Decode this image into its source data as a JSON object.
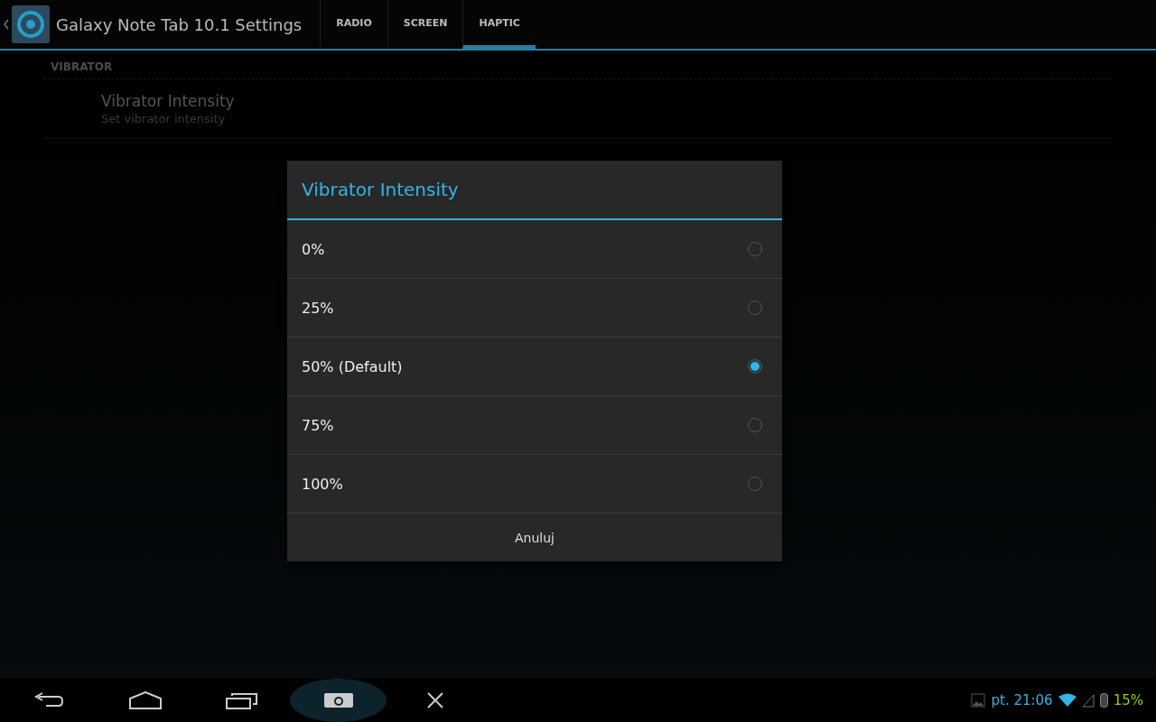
{
  "action_bar": {
    "title": "Galaxy Note Tab 10.1 Settings",
    "tabs": [
      {
        "label": "RADIO",
        "selected": false
      },
      {
        "label": "SCREEN",
        "selected": false
      },
      {
        "label": "HAPTIC",
        "selected": true
      }
    ]
  },
  "section": {
    "header": "VIBRATOR",
    "items": [
      {
        "title": "Vibrator Intensity",
        "summary": "Set vibrator intensity"
      }
    ]
  },
  "dialog": {
    "title": "Vibrator Intensity",
    "options": [
      {
        "label": "0%",
        "selected": false
      },
      {
        "label": "25%",
        "selected": false
      },
      {
        "label": "50% (Default)",
        "selected": true
      },
      {
        "label": "75%",
        "selected": false
      },
      {
        "label": "100%",
        "selected": false
      }
    ],
    "cancel": "Anuluj"
  },
  "status_bar": {
    "time": "pt. 21:06",
    "battery": "15%"
  }
}
